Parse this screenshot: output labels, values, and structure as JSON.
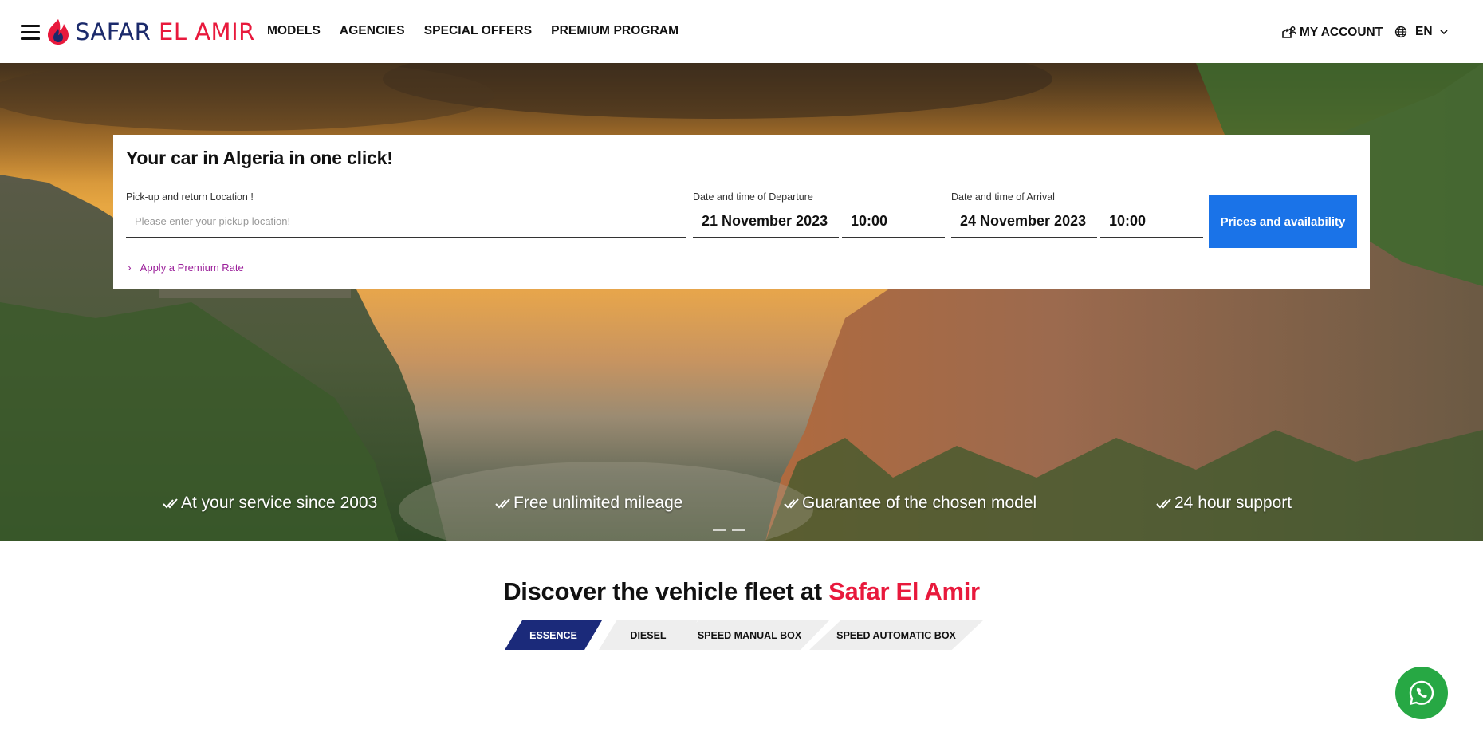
{
  "brand": {
    "part1": "SAFAR ",
    "part2": "EL AMIR",
    "colors": {
      "navy": "#1b2a6b",
      "red": "#e8193c"
    }
  },
  "nav": {
    "items": [
      {
        "label": "MODELS"
      },
      {
        "label": "AGENCIES"
      },
      {
        "label": "SPECIAL OFFERS"
      },
      {
        "label": "PREMIUM PROGRAM"
      }
    ]
  },
  "account": {
    "label": "MY ACCOUNT",
    "icon": "account-icon"
  },
  "language": {
    "current": "EN",
    "icon": "globe-icon"
  },
  "search": {
    "title": "Your car in Algeria in one click!",
    "location_label": "Pick-up and return Location !",
    "location_placeholder": "Please enter your pickup location!",
    "location_value": "",
    "departure_label": "Date and time of Departure",
    "departure_date": "21 November 2023",
    "departure_time": "10:00",
    "arrival_label": "Date and time of Arrival",
    "arrival_date": "24 November 2023",
    "arrival_time": "10:00",
    "submit_label": "Prices and availability",
    "premium_link": "Apply a Premium Rate",
    "accent_color": "#1a73e8"
  },
  "benefits": [
    {
      "label": "At your service since 2003"
    },
    {
      "label": "Free unlimited mileage"
    },
    {
      "label": "Guarantee of the chosen model"
    },
    {
      "label": "24 hour support"
    }
  ],
  "fleet": {
    "title_prefix": "Discover the vehicle fleet at ",
    "title_brand": "Safar El Amir",
    "tabs": [
      {
        "label": "ESSENCE",
        "active": true
      },
      {
        "label": "DIESEL",
        "active": false
      },
      {
        "label": "SPEED MANUAL BOX",
        "active": false
      },
      {
        "label": "SPEED AUTOMATIC BOX",
        "active": false
      }
    ]
  },
  "whatsapp": {
    "icon": "whatsapp-icon",
    "color": "#27a844"
  }
}
